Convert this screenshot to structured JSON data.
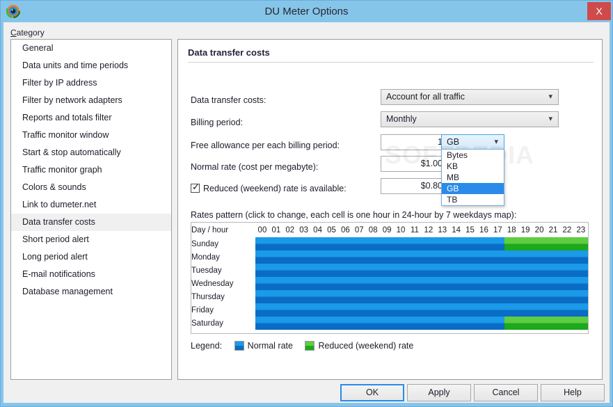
{
  "window": {
    "title": "DU Meter Options",
    "app_icon": "du-meter-eye-icon",
    "close_label": "X",
    "titlebar_color": "#86c5ea",
    "close_color": "#cf4b4b"
  },
  "sidebar": {
    "label": "Category",
    "accelerator": "C",
    "items": [
      {
        "label": "General",
        "selected": false
      },
      {
        "label": "Data units and time periods",
        "selected": false
      },
      {
        "label": "Filter by IP address",
        "selected": false
      },
      {
        "label": "Filter by network adapters",
        "selected": false
      },
      {
        "label": "Reports and totals filter",
        "selected": false
      },
      {
        "label": "Traffic monitor window",
        "selected": false
      },
      {
        "label": "Start & stop automatically",
        "selected": false
      },
      {
        "label": "Traffic monitor graph",
        "selected": false
      },
      {
        "label": "Colors & sounds",
        "selected": false
      },
      {
        "label": "Link to dumeter.net",
        "selected": false
      },
      {
        "label": "Data transfer costs",
        "selected": true
      },
      {
        "label": "Short period alert",
        "selected": false
      },
      {
        "label": "Long period alert",
        "selected": false
      },
      {
        "label": "E-mail notifications",
        "selected": false
      },
      {
        "label": "Database management",
        "selected": false
      }
    ]
  },
  "panel": {
    "title": "Data transfer costs",
    "fields": {
      "costs_label": "Data transfer costs:",
      "costs_value": "Account for all traffic",
      "billing_label": "Billing period:",
      "billing_value": "Monthly",
      "allowance_label": "Free allowance per each billing period:",
      "allowance_value": "1",
      "allowance_unit": "GB",
      "normal_rate_label": "Normal rate (cost per megabyte):",
      "normal_rate_value": "$1.00",
      "reduced_label": "Reduced (weekend) rate is available:",
      "reduced_checked": true,
      "reduced_rate_value": "$0.80"
    },
    "unit_dropdown": {
      "open": true,
      "options": [
        "Bytes",
        "KB",
        "MB",
        "GB",
        "TB"
      ],
      "selected": "GB"
    },
    "rates": {
      "caption": "Rates pattern (click to change, each cell is one hour in 24-hour by 7 weekdays map):",
      "corner_header": "Day / hour",
      "hours": [
        "00",
        "01",
        "02",
        "03",
        "04",
        "05",
        "06",
        "07",
        "08",
        "09",
        "10",
        "11",
        "12",
        "13",
        "14",
        "15",
        "16",
        "17",
        "18",
        "19",
        "20",
        "21",
        "22",
        "23"
      ],
      "days": [
        "Sunday",
        "Monday",
        "Tuesday",
        "Wednesday",
        "Thursday",
        "Friday",
        "Saturday"
      ],
      "pattern": [
        [
          "n",
          "n",
          "n",
          "n",
          "n",
          "n",
          "n",
          "n",
          "n",
          "n",
          "n",
          "n",
          "n",
          "n",
          "n",
          "n",
          "n",
          "n",
          "r",
          "r",
          "r",
          "r",
          "r",
          "r"
        ],
        [
          "n",
          "n",
          "n",
          "n",
          "n",
          "n",
          "n",
          "n",
          "n",
          "n",
          "n",
          "n",
          "n",
          "n",
          "n",
          "n",
          "n",
          "n",
          "n",
          "n",
          "n",
          "n",
          "n",
          "n"
        ],
        [
          "n",
          "n",
          "n",
          "n",
          "n",
          "n",
          "n",
          "n",
          "n",
          "n",
          "n",
          "n",
          "n",
          "n",
          "n",
          "n",
          "n",
          "n",
          "n",
          "n",
          "n",
          "n",
          "n",
          "n"
        ],
        [
          "n",
          "n",
          "n",
          "n",
          "n",
          "n",
          "n",
          "n",
          "n",
          "n",
          "n",
          "n",
          "n",
          "n",
          "n",
          "n",
          "n",
          "n",
          "n",
          "n",
          "n",
          "n",
          "n",
          "n"
        ],
        [
          "n",
          "n",
          "n",
          "n",
          "n",
          "n",
          "n",
          "n",
          "n",
          "n",
          "n",
          "n",
          "n",
          "n",
          "n",
          "n",
          "n",
          "n",
          "n",
          "n",
          "n",
          "n",
          "n",
          "n"
        ],
        [
          "n",
          "n",
          "n",
          "n",
          "n",
          "n",
          "n",
          "n",
          "n",
          "n",
          "n",
          "n",
          "n",
          "n",
          "n",
          "n",
          "n",
          "n",
          "n",
          "n",
          "n",
          "n",
          "n",
          "n"
        ],
        [
          "n",
          "n",
          "n",
          "n",
          "n",
          "n",
          "n",
          "n",
          "n",
          "n",
          "n",
          "n",
          "n",
          "n",
          "n",
          "n",
          "n",
          "n",
          "r",
          "r",
          "r",
          "r",
          "r",
          "r"
        ]
      ],
      "normal_color": "#1a9ae8",
      "reduced_color": "#3cbc28"
    },
    "legend": {
      "title": "Legend:",
      "normal_label": "Normal rate",
      "reduced_label": "Reduced (weekend) rate"
    }
  },
  "buttons": {
    "ok": "OK",
    "apply": "Apply",
    "cancel": "Cancel",
    "help": "Help"
  },
  "watermark": "SOFTPEDIA"
}
